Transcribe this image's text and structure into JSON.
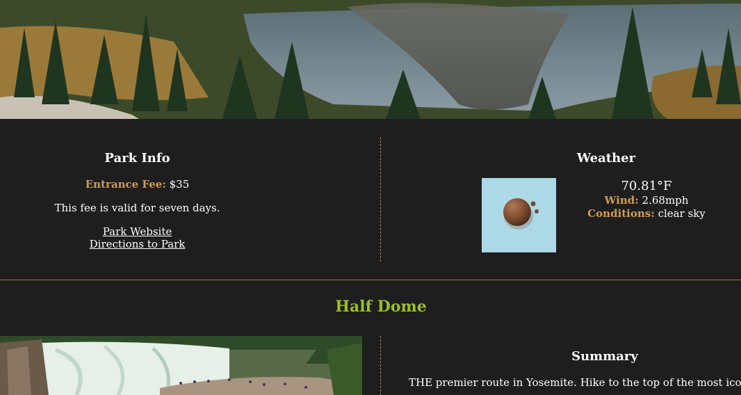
{
  "hero": {
    "alt": "Mountain lake reflection with pine trees"
  },
  "park_info": {
    "heading": "Park Info",
    "fee_label": "Entrance Fee:",
    "fee_value": "$35",
    "fee_note": "This fee is valid for seven days.",
    "links": {
      "website": "Park Website",
      "directions": "Directions to Park"
    }
  },
  "weather": {
    "heading": "Weather",
    "icon": "clear-sky-icon",
    "temperature": "70.81°F",
    "wind_label": "Wind:",
    "wind_value": "2.68mph",
    "conditions_label": "Conditions:",
    "conditions_value": "clear sky"
  },
  "trail": {
    "title": "Half Dome",
    "photo_alt": "Waterfall with hikers on rocks",
    "summary_heading": "Summary",
    "summary_text": "THE premier route in Yosemite. Hike to the top of the most iconic granite dome"
  },
  "colors": {
    "background": "#1e1e1e",
    "accent_label": "#d19a57",
    "trail_title": "#9bbf2a",
    "weather_icon_bg": "#add8e6"
  }
}
